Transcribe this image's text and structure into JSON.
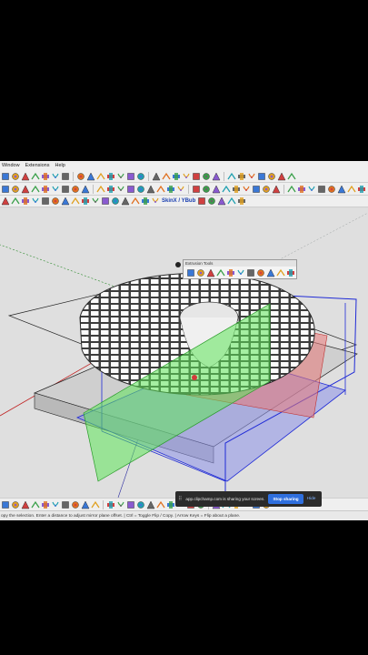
{
  "menu": {
    "items": [
      "Window",
      "Extensions",
      "Help"
    ]
  },
  "toolbar1": {
    "icons": [
      "orbit-icon",
      "pan-icon",
      "zoom-icon",
      "zoom-extents-icon",
      "previous-view-icon",
      "next-view-icon",
      "camera-icon",
      "section-plane-icon",
      "display-section-icon",
      "layers-icon",
      "materials-icon",
      "components-icon",
      "styles-icon",
      "shadows-icon",
      "fog-icon",
      "scenes-icon",
      "model-info-icon",
      "entity-info-icon",
      "outliner-icon",
      "instructor-icon",
      "warehouse-icon",
      "extension-warehouse-icon",
      "send-to-layout-icon",
      "sandbox-icon",
      "geolocation-icon",
      "solid-tools-icon",
      "dynamic-components-icon",
      "measure-icon"
    ]
  },
  "toolbar2": {
    "icons": [
      "select-icon",
      "eraser-icon",
      "paint-icon",
      "line-icon",
      "arc-icon",
      "rectangle-icon",
      "circle-icon",
      "polygon-icon",
      "push-pull-icon",
      "move-icon",
      "rotate-icon",
      "scale-icon",
      "offset-icon",
      "follow-me-icon",
      "tape-measure-icon",
      "protractor-icon",
      "dimension-icon",
      "text-icon",
      "axes-icon",
      "3d-text-icon",
      "walk-icon",
      "look-around-icon",
      "position-camera-icon",
      "iso-view-icon",
      "top-view-icon",
      "front-view-icon",
      "right-view-icon",
      "back-view-icon",
      "left-view-icon",
      "bottom-view-icon",
      "xray-icon",
      "back-edges-icon",
      "wireframe-icon",
      "hidden-line-icon",
      "shaded-icon",
      "shaded-textures-icon",
      "monochrome-icon",
      "help-icon"
    ]
  },
  "toolbar3": {
    "skin_label": "SkinX",
    "ybub_label": "YBub",
    "icons": [
      "curviloft-icon",
      "bezier-icon",
      "freehand-icon",
      "spline-icon",
      "arc-tool-icon",
      "polyline-icon",
      "vertex-icon",
      "extrude-icon",
      "joint-push-pull-icon",
      "fredo-scale-icon",
      "round-corner-icon",
      "tools-on-surface-icon",
      "shape-bender-icon",
      "weld-icon",
      "subdivide-icon",
      "artisan-icon",
      "quadface-icon",
      "flowify-icon",
      "profile-builder-icon",
      "lattice-icon",
      "mirror-icon"
    ]
  },
  "extension_panel": {
    "title": "Extrusion Tools",
    "icons": [
      "extrude-edges-by-vector-icon",
      "extrude-edges-by-face-icon",
      "extrude-edges-by-edges-icon",
      "extrude-edges-by-rails-icon",
      "extrude-edges-by-loft-icon",
      "extrude-edges-by-rails-lathe-icon",
      "extrude-edges-by-rails-tile-icon",
      "extrude-edges-by-rails-mesh-icon",
      "extrude-edges-by-rails-sweep-icon",
      "extrude-lines-icon",
      "extrude-edges-by-vector-to-object-icon"
    ]
  },
  "bottom_toolbar": {
    "icons": [
      "undo-icon",
      "redo-icon",
      "cut-icon",
      "copy-icon",
      "paste-icon",
      "erase-icon",
      "filter-icon",
      "settings-icon",
      "diamond-icon",
      "gem-icon",
      "group-icon",
      "component-icon",
      "lock-icon",
      "play-icon",
      "pause-icon",
      "align-icon",
      "move-icon",
      "pin-icon",
      "grid-icon",
      "mirror-icon",
      "warning-icon",
      "flag-icon",
      "cube-icon",
      "hat-icon",
      "chart-icon",
      "star-icon"
    ]
  },
  "share_banner": {
    "text": "app.clipchamp.com is sharing your screen.",
    "stop_label": "Stop sharing",
    "hide_label": "Hide"
  },
  "status_bar": {
    "text": "opy the selection. Enter a distance to adjust mirror plane offset. | Ctrl = Toggle Flip / Copy. | Arrow Keys = Flip about a plane."
  },
  "colors": {
    "viewport_bg": "#dfdfdf",
    "mirror_plane_green": "#5fe65a",
    "mirror_plane_red": "#e77878",
    "mirror_plane_blue": "#8c92e8",
    "selection_blue": "#1f2ad6",
    "share_button": "#2f6fde"
  }
}
